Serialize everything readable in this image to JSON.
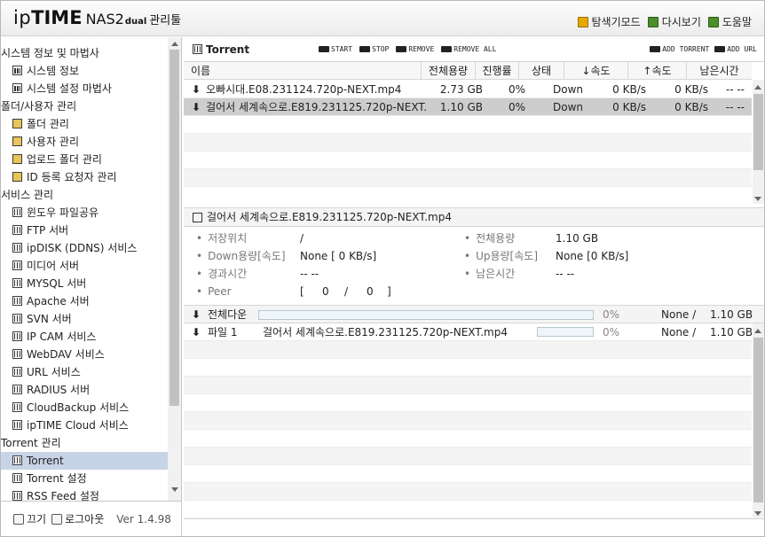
{
  "header": {
    "brand_a": "ip",
    "brand_b": "TIME",
    "model": "NAS2",
    "model_suffix": "dual",
    "admin": "관리툴",
    "links": [
      {
        "label": "탐색기모드",
        "icon": "explorer-icon"
      },
      {
        "label": "다시보기",
        "icon": "refresh-icon"
      },
      {
        "label": "도움말",
        "icon": "help-icon"
      }
    ]
  },
  "sidebar": {
    "items": [
      {
        "type": "group",
        "label": "시스템 정보 및 마법사"
      },
      {
        "type": "item",
        "label": "시스템 정보",
        "icon": "chart-icon"
      },
      {
        "type": "item",
        "label": "시스템 설정 마법사",
        "icon": "chart-icon"
      },
      {
        "type": "group",
        "label": "폴더/사용자 관리"
      },
      {
        "type": "item",
        "label": "폴더 관리",
        "icon": "folder-icon"
      },
      {
        "type": "item",
        "label": "사용자 관리",
        "icon": "folder-icon"
      },
      {
        "type": "item",
        "label": "업로드 폴더 관리",
        "icon": "folder-icon"
      },
      {
        "type": "item",
        "label": "ID 등록 요청자 관리",
        "icon": "folder-icon"
      },
      {
        "type": "group",
        "label": "서비스 관리"
      },
      {
        "type": "item",
        "label": "윈도우 파일공유",
        "icon": "grid-icon"
      },
      {
        "type": "item",
        "label": "FTP 서버",
        "icon": "grid-icon"
      },
      {
        "type": "item",
        "label": "ipDISK (DDNS) 서비스",
        "icon": "grid-icon"
      },
      {
        "type": "item",
        "label": "미디어 서버",
        "icon": "grid-icon"
      },
      {
        "type": "item",
        "label": "MYSQL 서버",
        "icon": "grid-icon"
      },
      {
        "type": "item",
        "label": "Apache 서버",
        "icon": "grid-icon"
      },
      {
        "type": "item",
        "label": "SVN 서버",
        "icon": "grid-icon"
      },
      {
        "type": "item",
        "label": "IP CAM 서비스",
        "icon": "grid-icon"
      },
      {
        "type": "item",
        "label": "WebDAV 서비스",
        "icon": "grid-icon"
      },
      {
        "type": "item",
        "label": "URL 서비스",
        "icon": "grid-icon"
      },
      {
        "type": "item",
        "label": "RADIUS 서버",
        "icon": "grid-icon"
      },
      {
        "type": "item",
        "label": "CloudBackup 서비스",
        "icon": "grid-icon"
      },
      {
        "type": "item",
        "label": "ipTIME Cloud 서비스",
        "icon": "grid-icon"
      },
      {
        "type": "group",
        "label": "Torrent 관리"
      },
      {
        "type": "item",
        "label": "Torrent",
        "icon": "grid-icon",
        "selected": true
      },
      {
        "type": "item",
        "label": "Torrent 설정",
        "icon": "grid-icon"
      },
      {
        "type": "item",
        "label": "RSS Feed 설정",
        "icon": "grid-icon"
      }
    ]
  },
  "footer": {
    "off": "끄기",
    "logout": "로그아웃",
    "version": "Ver 1.4.98"
  },
  "toolbar": {
    "title": "Torrent",
    "start": "START",
    "stop": "STOP",
    "remove": "REMOVE",
    "remove_all": "REMOVE ALL",
    "add_torrent": "ADD TORRENT",
    "add_url": "ADD URL"
  },
  "torrent_list": {
    "columns": [
      "이름",
      "전체용량",
      "진행률",
      "상태",
      "↓속도",
      "↑속도",
      "남은시간"
    ],
    "rows": [
      {
        "name": "오빠시대.E08.231124.720p-NEXT.mp4",
        "size": "2.73 GB",
        "progress": "0%",
        "status": "Down",
        "down": "0 KB/s",
        "up": "0 KB/s",
        "remaining": "-- --"
      },
      {
        "name": "걸어서 세계속으로.E819.231125.720p-NEXT...",
        "size": "1.10 GB",
        "progress": "0%",
        "status": "Down",
        "down": "0 KB/s",
        "up": "0 KB/s",
        "remaining": "-- --",
        "selected": true
      }
    ]
  },
  "detail": {
    "title": "걸어서 세계속으로.E819.231125.720p-NEXT.mp4",
    "save_path_label": "저장위치",
    "save_path": "/",
    "total_size_label": "전체용량",
    "total_size": "1.10 GB",
    "down_label": "Down용량[속도]",
    "down": "None [ 0 KB/s]",
    "up_label": "Up용량[속도]",
    "up": "None [0 KB/s]",
    "elapsed_label": "경과시간",
    "elapsed": "-- --",
    "remaining_label": "남은시간",
    "remaining": "-- --",
    "peer_label": "Peer",
    "peer_open": "[",
    "peer_a": "0",
    "peer_sep": "/",
    "peer_b": "0",
    "peer_close": "]"
  },
  "total": {
    "label": "전체다운",
    "percent": "0%",
    "progress": 0,
    "done": "None /",
    "size": "1.10 GB"
  },
  "files": [
    {
      "label": "파일 1",
      "name": "걸어서 세계속으로.E819.231125.720p-NEXT.mp4",
      "percent": "0%",
      "progress": 0,
      "done": "None /",
      "size": "1.10 GB"
    }
  ]
}
